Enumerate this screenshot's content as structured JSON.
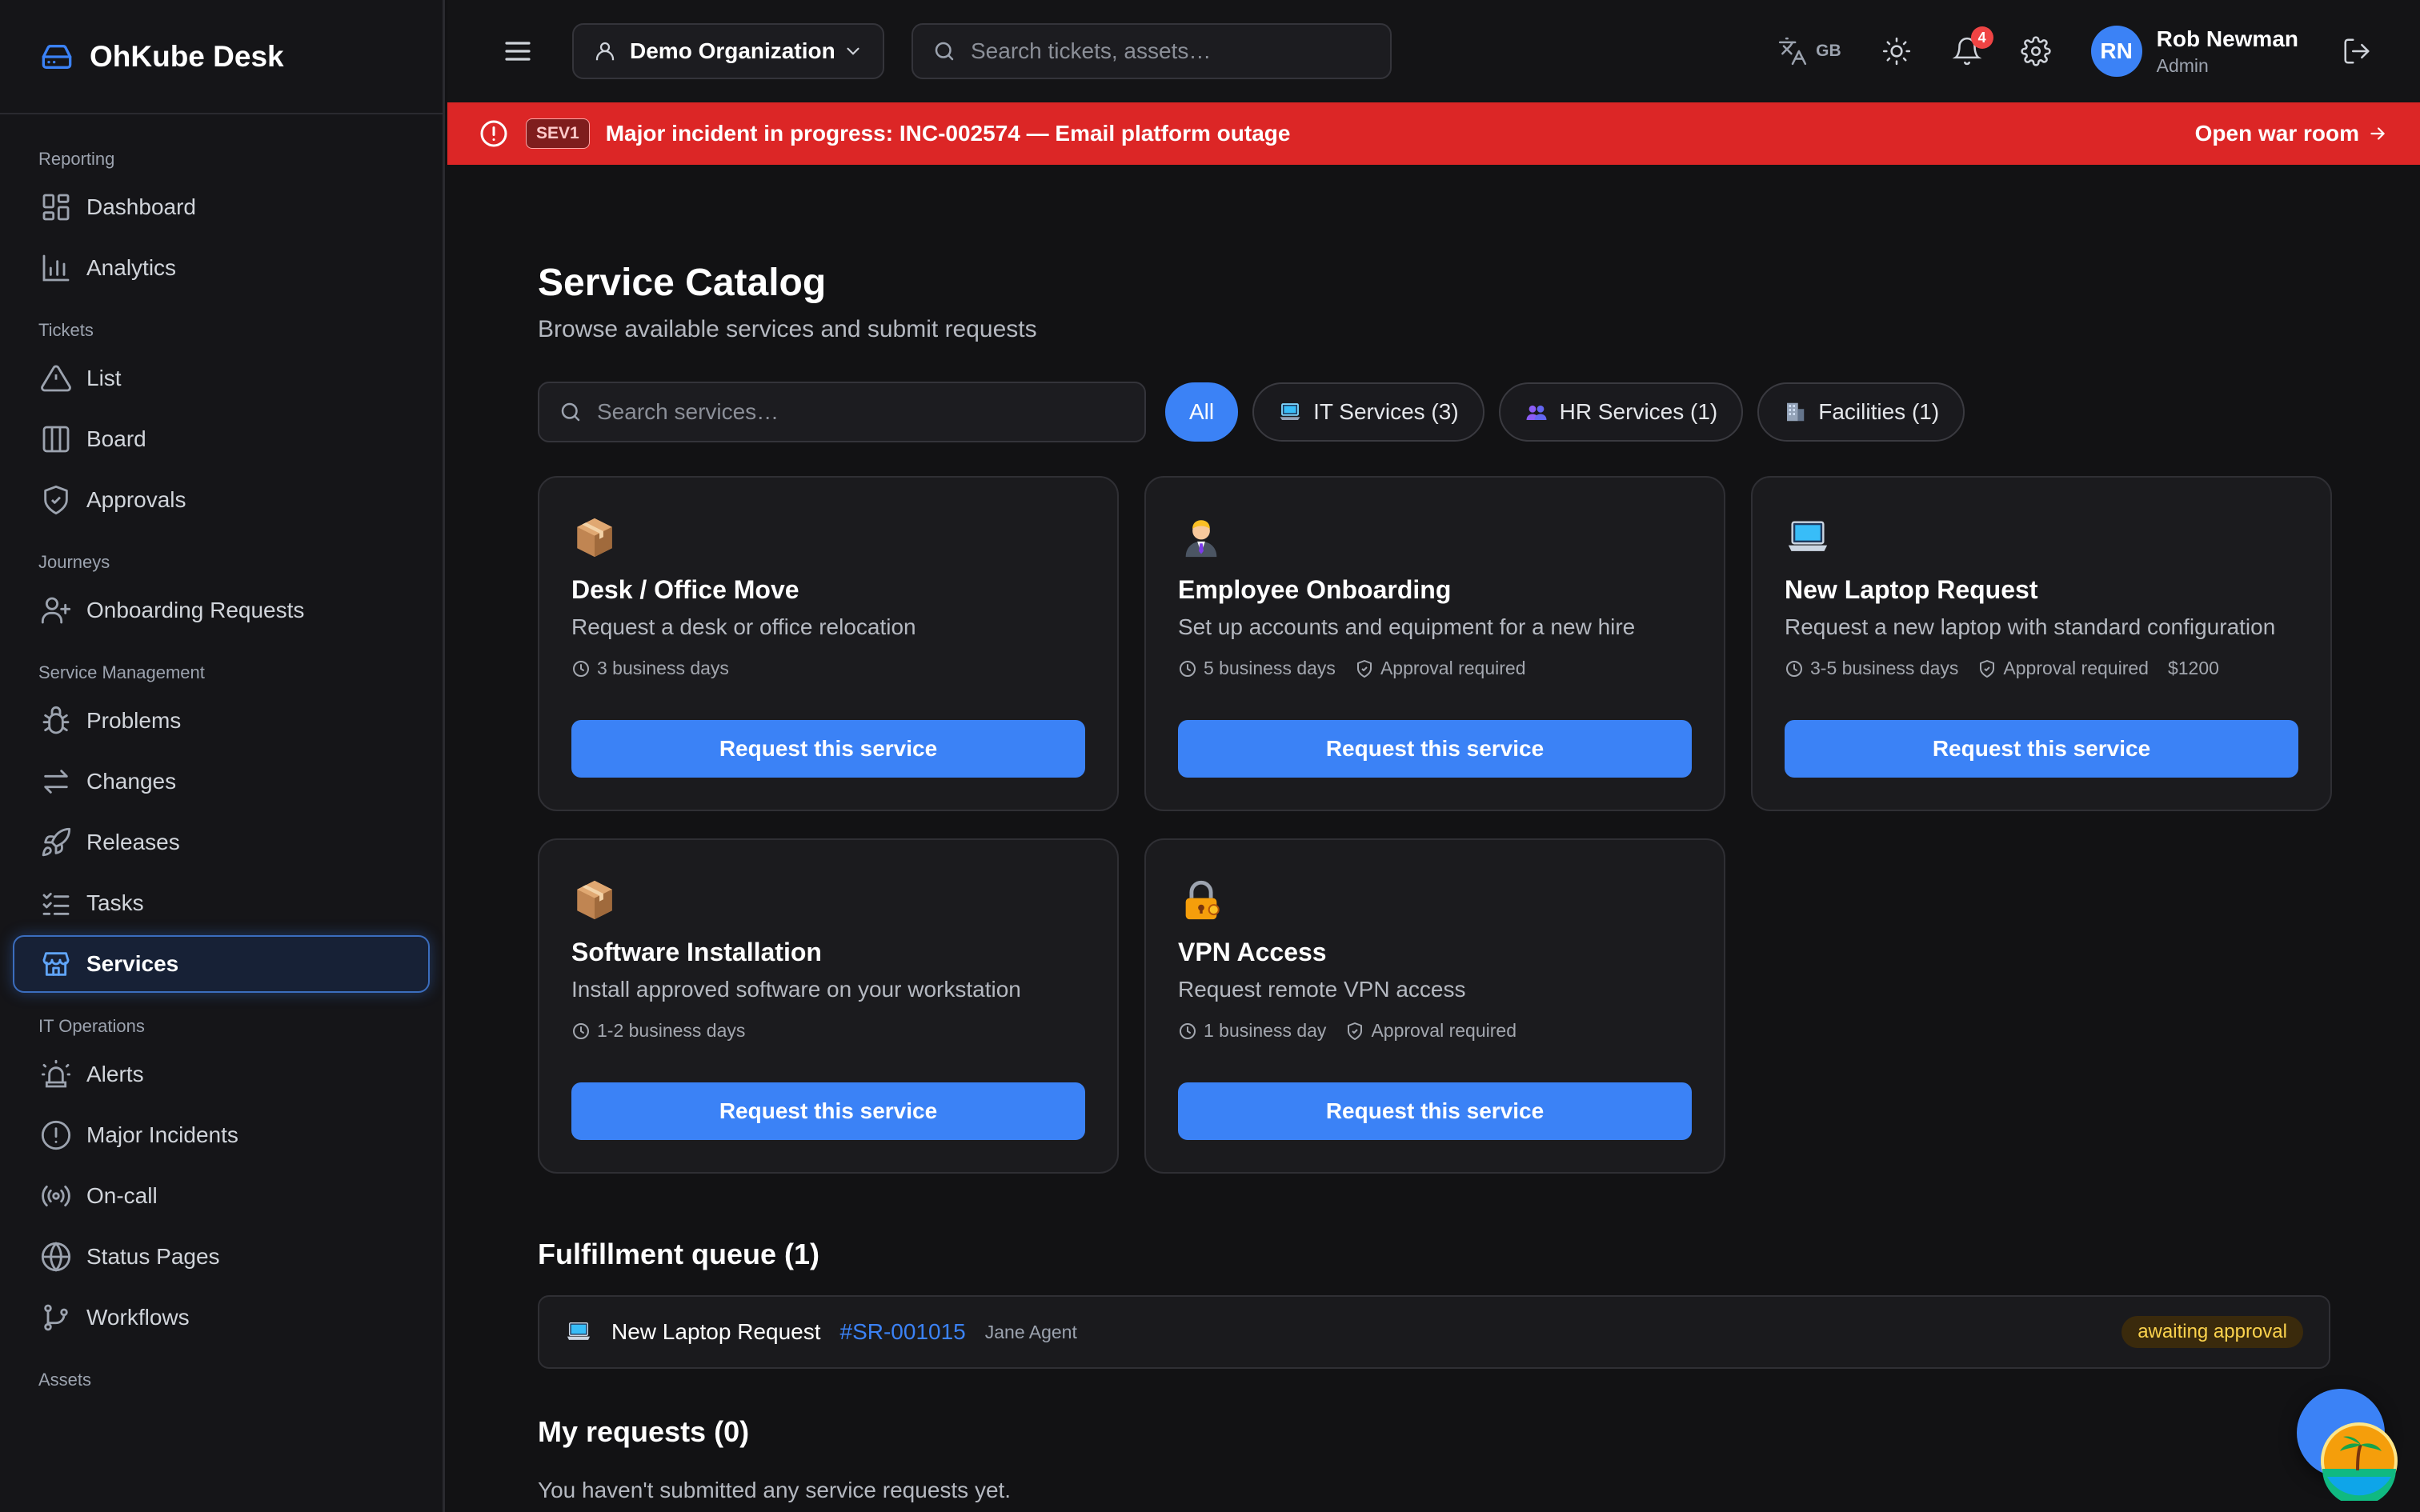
{
  "app": {
    "name": "OhKube Desk"
  },
  "sidebar": {
    "sections": [
      {
        "title": "Reporting",
        "items": [
          {
            "label": "Dashboard",
            "icon": "dashboard-icon"
          },
          {
            "label": "Analytics",
            "icon": "analytics-icon"
          }
        ]
      },
      {
        "title": "Tickets",
        "items": [
          {
            "label": "List",
            "icon": "alert-triangle-icon"
          },
          {
            "label": "Board",
            "icon": "board-icon"
          },
          {
            "label": "Approvals",
            "icon": "shield-check-icon"
          }
        ]
      },
      {
        "title": "Journeys",
        "items": [
          {
            "label": "Onboarding Requests",
            "icon": "user-plus-icon"
          }
        ]
      },
      {
        "title": "Service Management",
        "items": [
          {
            "label": "Problems",
            "icon": "bug-icon"
          },
          {
            "label": "Changes",
            "icon": "arrows-swap-icon"
          },
          {
            "label": "Releases",
            "icon": "rocket-icon"
          },
          {
            "label": "Tasks",
            "icon": "list-checks-icon"
          },
          {
            "label": "Services",
            "icon": "store-icon",
            "active": true
          }
        ]
      },
      {
        "title": "IT Operations",
        "items": [
          {
            "label": "Alerts",
            "icon": "siren-icon"
          },
          {
            "label": "Major Incidents",
            "icon": "alert-circle-icon"
          },
          {
            "label": "On-call",
            "icon": "radio-icon"
          },
          {
            "label": "Status Pages",
            "icon": "globe-icon"
          },
          {
            "label": "Workflows",
            "icon": "workflow-icon"
          }
        ]
      },
      {
        "title": "Assets",
        "items": []
      }
    ]
  },
  "header": {
    "org_label": "Demo Organization",
    "search_placeholder": "Search tickets, assets…",
    "lang_code": "GB",
    "notification_count": "4",
    "user": {
      "initials": "RN",
      "name": "Rob Newman",
      "role": "Admin"
    }
  },
  "banner": {
    "severity": "SEV1",
    "message": "Major incident in progress: INC-002574 — Email platform outage",
    "action": "Open war room",
    "color": "#dc2626"
  },
  "main": {
    "title": "Service Catalog",
    "subtitle": "Browse available services and submit requests",
    "search_placeholder": "Search services…",
    "filters": [
      {
        "label": "All",
        "active": true
      },
      {
        "label": "IT Services (3)",
        "icon": "laptop-icon"
      },
      {
        "label": "HR Services (1)",
        "icon": "people-icon"
      },
      {
        "label": "Facilities (1)",
        "icon": "building-icon"
      }
    ],
    "cards": [
      {
        "emoji": "package-icon",
        "title": "Desk / Office Move",
        "desc": "Request a desk or office relocation",
        "time": "3 business days",
        "approval": "",
        "price": "",
        "button": "Request this service"
      },
      {
        "emoji": "office-worker-icon",
        "title": "Employee Onboarding",
        "desc": "Set up accounts and equipment for a new hire",
        "time": "5 business days",
        "approval": "Approval required",
        "price": "",
        "button": "Request this service"
      },
      {
        "emoji": "laptop-icon",
        "title": "New Laptop Request",
        "desc": "Request a new laptop with standard configuration",
        "time": "3-5 business days",
        "approval": "Approval required",
        "price": "$1200",
        "button": "Request this service"
      },
      {
        "emoji": "package-icon",
        "title": "Software Installation",
        "desc": "Install approved software on your workstation",
        "time": "1-2 business days",
        "approval": "",
        "price": "",
        "button": "Request this service"
      },
      {
        "emoji": "lock-key-icon",
        "title": "VPN Access",
        "desc": "Request remote VPN access",
        "time": "1 business day",
        "approval": "Approval required",
        "price": "",
        "button": "Request this service"
      }
    ],
    "queue_title": "Fulfillment queue (1)",
    "queue": [
      {
        "icon": "laptop-icon",
        "name": "New Laptop Request",
        "id": "#SR-001015",
        "agent": "Jane Agent",
        "status": "awaiting approval"
      }
    ],
    "my_requests_title": "My requests (0)",
    "my_requests_empty": "You haven't submitted any service requests yet."
  },
  "colors": {
    "accent": "#3b82f6",
    "banner": "#dc2626",
    "background": "#121214",
    "status_awaiting": "#fcd34d"
  }
}
